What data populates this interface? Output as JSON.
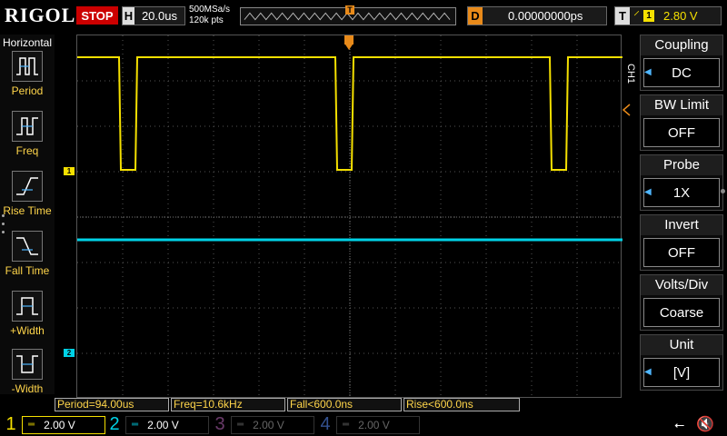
{
  "header": {
    "brand": "RIGOL",
    "run_state": "STOP",
    "timebase_key": "H",
    "timebase": "20.0us",
    "sample_rate": "500MSa/s",
    "memory_depth": "120k pts",
    "delay_key": "D",
    "delay": "0.00000000ps",
    "trigger_key": "T",
    "trigger_source": "1",
    "trigger_level": "2.80 V",
    "trigger_position_marker": "T"
  },
  "left_menu": {
    "title": "Horizontal",
    "items": [
      {
        "label": "Period",
        "icon": "period-icon"
      },
      {
        "label": "Freq",
        "icon": "freq-icon"
      },
      {
        "label": "Rise Time",
        "icon": "rise-time-icon"
      },
      {
        "label": "Fall Time",
        "icon": "fall-time-icon"
      },
      {
        "label": "+Width",
        "icon": "positive-width-icon"
      },
      {
        "label": "-Width",
        "icon": "negative-width-icon"
      }
    ]
  },
  "right_menu": {
    "channel_tab": "CH1",
    "items": [
      {
        "label": "Coupling",
        "value": "DC",
        "has_arrow": true
      },
      {
        "label": "BW Limit",
        "value": "OFF",
        "has_arrow": false
      },
      {
        "label": "Probe",
        "value": "1X",
        "has_arrow": true
      },
      {
        "label": "Invert",
        "value": "OFF",
        "has_arrow": false
      },
      {
        "label": "Volts/Div",
        "value": "Coarse",
        "has_arrow": false
      },
      {
        "label": "Unit",
        "value": "[V]",
        "has_arrow": true
      }
    ]
  },
  "measurements": [
    {
      "text": "Period=94.00us"
    },
    {
      "text": "Freq=10.6kHz"
    },
    {
      "text": "Fall<600.0ns"
    },
    {
      "text": "Rise<600.0ns"
    }
  ],
  "channels": [
    {
      "number": "1",
      "scale": "2.00 V",
      "color": "#f5e000",
      "active": true
    },
    {
      "number": "2",
      "scale": "2.00 V",
      "color": "#00d2e6",
      "active": true
    },
    {
      "number": "3",
      "scale": "2.00 V",
      "color": "#b048b0",
      "active": false
    },
    {
      "number": "4",
      "scale": "2.00 V",
      "color": "#3a6ee8",
      "active": false
    }
  ],
  "colors": {
    "ch1": "#f5e000",
    "ch2": "#00d2e6",
    "trigger": "#e88a1a",
    "stop": "#cc0000",
    "label_text": "#ffd54a"
  },
  "icons": {
    "usb": "usb-icon",
    "speaker": "speaker-muted-icon"
  }
}
